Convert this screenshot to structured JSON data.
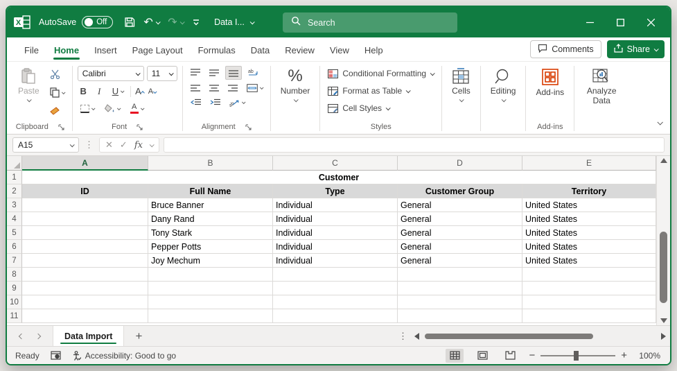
{
  "titlebar": {
    "autosave_label": "AutoSave",
    "autosave_state": "Off",
    "doc_title": "Data I...",
    "search_placeholder": "Search"
  },
  "menu": {
    "tabs": [
      "File",
      "Home",
      "Insert",
      "Page Layout",
      "Formulas",
      "Data",
      "Review",
      "View",
      "Help"
    ],
    "active_tab": "Home",
    "comments_label": "Comments",
    "share_label": "Share"
  },
  "ribbon": {
    "clipboard": {
      "group_label": "Clipboard",
      "paste_label": "Paste"
    },
    "font": {
      "group_label": "Font",
      "font_name": "Calibri",
      "font_size": "11",
      "bold_label": "B",
      "italic_label": "I",
      "underline_label": "U"
    },
    "alignment": {
      "group_label": "Alignment"
    },
    "number": {
      "button_label": "Number"
    },
    "styles": {
      "group_label": "Styles",
      "conditional_formatting_label": "Conditional Formatting",
      "format_as_table_label": "Format as Table",
      "cell_styles_label": "Cell Styles"
    },
    "cells": {
      "button_label": "Cells"
    },
    "editing": {
      "button_label": "Editing"
    },
    "addins": {
      "group_label": "Add-ins",
      "button_label": "Add-ins"
    },
    "analyze": {
      "button_label": "Analyze Data"
    }
  },
  "formula_bar": {
    "name_box_value": "A15",
    "fx_label": "fx"
  },
  "grid": {
    "columns": [
      "A",
      "B",
      "C",
      "D",
      "E"
    ],
    "selected_column": "A",
    "visible_rows": 11,
    "merged_title_row": {
      "row": 1,
      "text": "Customer"
    },
    "header_row": {
      "row": 2,
      "values": [
        "ID",
        "Full Name",
        "Type",
        "Customer Group",
        "Territory"
      ]
    },
    "data_rows": [
      {
        "row": 3,
        "values": [
          "",
          "Bruce Banner",
          "Individual",
          "General",
          "United States"
        ]
      },
      {
        "row": 4,
        "values": [
          "",
          "Dany Rand",
          "Individual",
          "General",
          "United States"
        ]
      },
      {
        "row": 5,
        "values": [
          "",
          "Tony Stark",
          "Individual",
          "General",
          "United States"
        ]
      },
      {
        "row": 6,
        "values": [
          "",
          "Pepper Potts",
          "Individual",
          "General",
          "United States"
        ]
      },
      {
        "row": 7,
        "values": [
          "",
          "Joy Mechum",
          "Individual",
          "General",
          "United States"
        ]
      }
    ]
  },
  "sheet_bar": {
    "active_sheet": "Data Import"
  },
  "status_bar": {
    "ready_label": "Ready",
    "accessibility_label": "Accessibility: Good to go",
    "zoom_value": "100%"
  },
  "colors": {
    "excel_green": "#107C41",
    "row_header_fill": "#D9D9D9",
    "addins_orange": "#D83B01",
    "font_color_red": "#E81123",
    "grid_line": "#DCDAD8"
  }
}
